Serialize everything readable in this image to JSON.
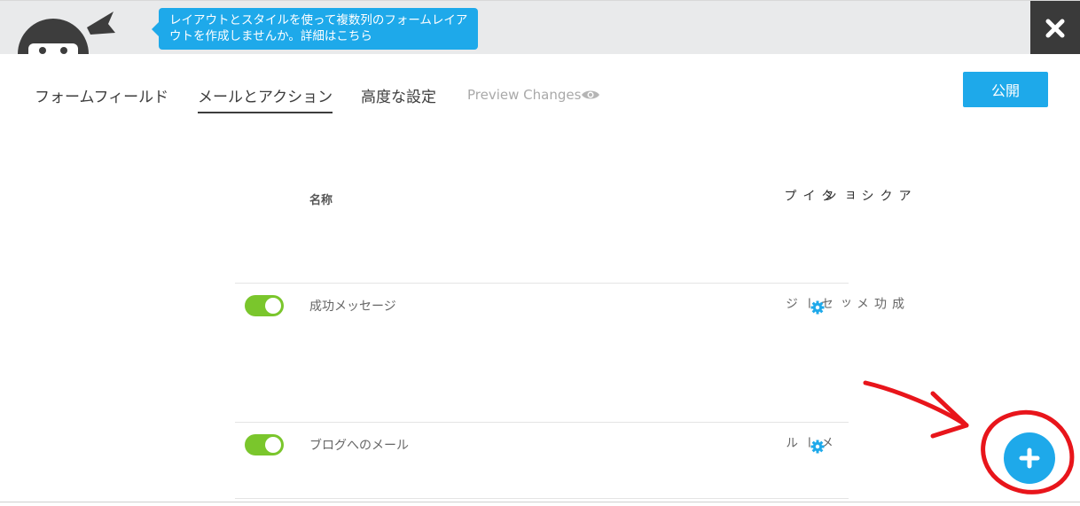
{
  "tooltip": {
    "text": "レイアウトとスタイルを使って複数列のフォームレイアウトを作成しませんか。詳細はこちら"
  },
  "tabs": [
    {
      "label": "フォームフィールド"
    },
    {
      "label": "メールとアクション"
    },
    {
      "label": "高度な設定"
    },
    {
      "label": "Preview Changes"
    }
  ],
  "active_tab": "メールとアクション",
  "publish_label": "公開",
  "table": {
    "col_name": "名称",
    "col_type": "タイプ",
    "col_action": "アクション",
    "rows": [
      {
        "enabled": true,
        "name": "成功メッセージ",
        "type": "成功メッセージ"
      },
      {
        "enabled": true,
        "name": "ブログへのメール",
        "type": "メール"
      }
    ]
  },
  "icons": {
    "close": "close-icon",
    "eye": "eye-icon",
    "gear": "gear-icon",
    "add": "plus-icon"
  },
  "colors": {
    "accent": "#1ea9ea",
    "toggle_on": "#7ac62c",
    "annotation": "#e8151b",
    "close_bg": "#3a3a3a"
  }
}
